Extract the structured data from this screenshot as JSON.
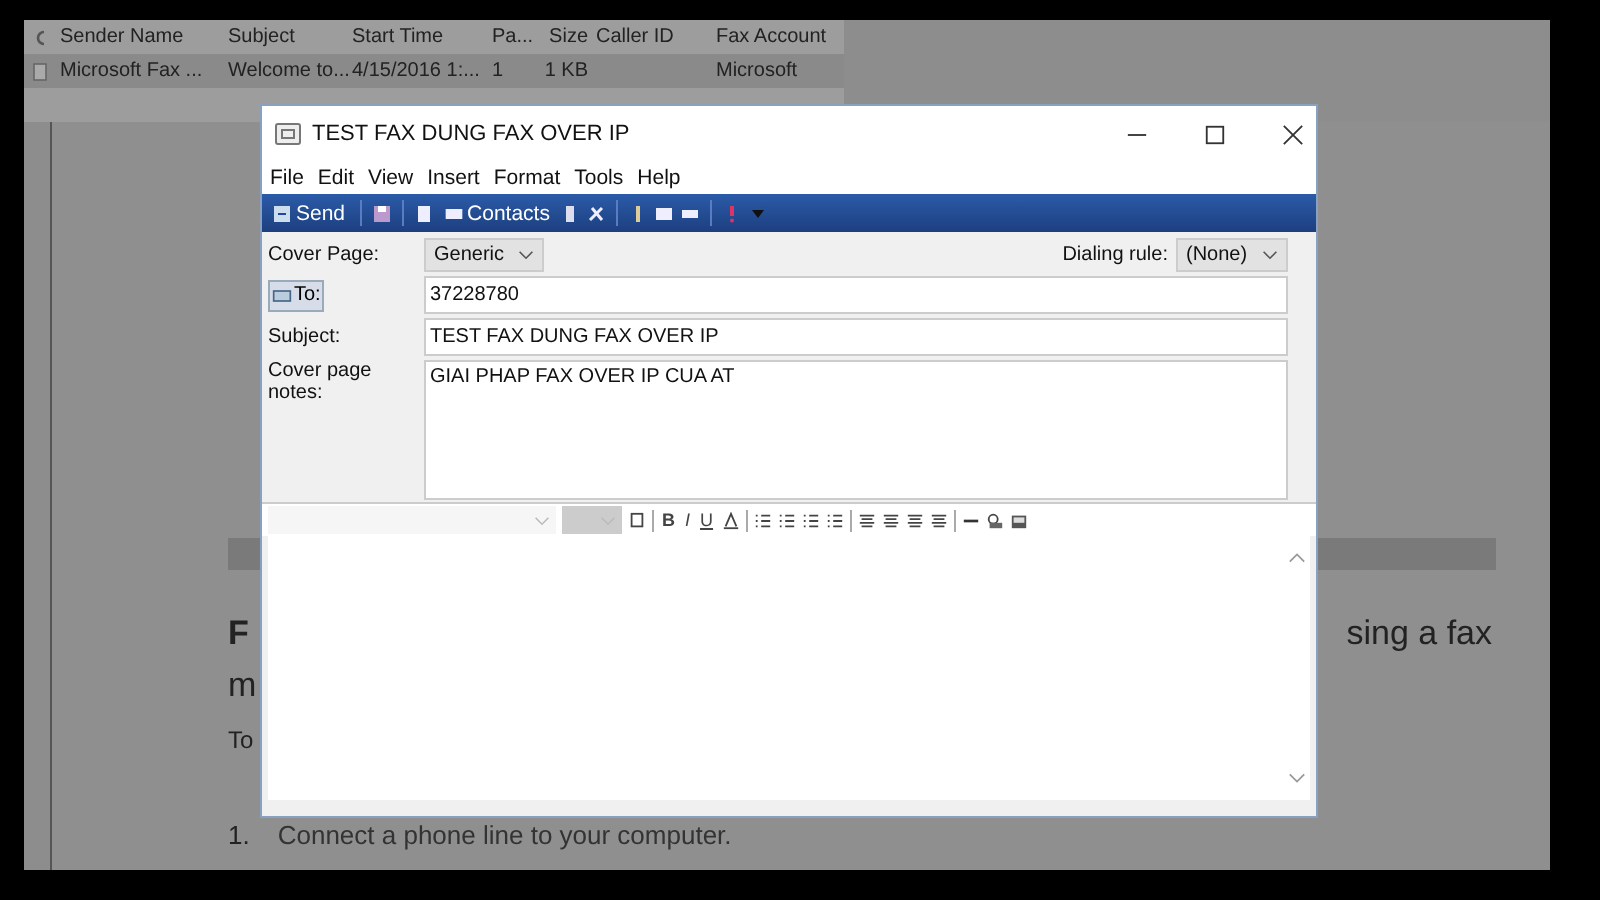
{
  "message_list": {
    "columns": [
      "Sender Name",
      "Subject",
      "Start Time",
      "Pa...",
      "Size",
      "Caller ID",
      "Fax Account"
    ],
    "rows": [
      {
        "selected": true,
        "cells": [
          "Microsoft Fax ...",
          "Welcome to...",
          "4/15/2016 1:...",
          "1",
          "1 KB",
          "",
          "Microsoft"
        ]
      }
    ]
  },
  "background_doc": {
    "line_1_start": "F",
    "line_1_end": "sing a fax",
    "line_2": "m",
    "line_3": "To",
    "step_number": "1.",
    "step_text": "Connect a phone line to your computer."
  },
  "dialog": {
    "title": "TEST FAX DUNG FAX OVER IP",
    "menu": [
      "File",
      "Edit",
      "View",
      "Insert",
      "Format",
      "Tools",
      "Help"
    ],
    "toolbar": {
      "send": "Send",
      "contacts": "Contacts"
    },
    "cover_page": {
      "label": "Cover Page:",
      "value": "Generic"
    },
    "dialing_rule": {
      "label": "Dialing rule:",
      "value": "(None)"
    },
    "to": {
      "label": "To:",
      "value": "37228780"
    },
    "subject": {
      "label": "Subject:",
      "value": "TEST FAX DUNG FAX OVER IP"
    },
    "notes": {
      "label": "Cover page notes:",
      "value": "GIAI PHAP FAX OVER IP CUA AT"
    },
    "format_buttons": [
      "B",
      "I",
      "U"
    ]
  }
}
